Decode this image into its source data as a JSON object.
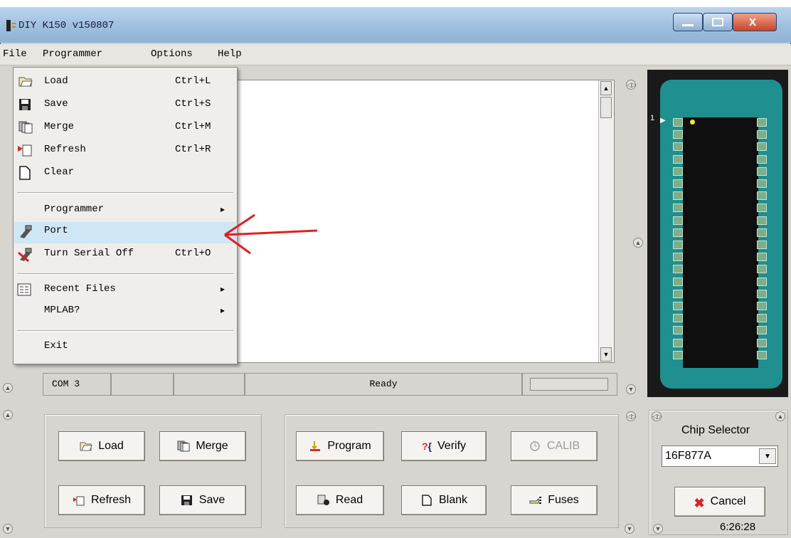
{
  "window": {
    "title": "DIY K150 v150807"
  },
  "menubar": {
    "items": [
      "File",
      "Programmer",
      "Options",
      "Help"
    ]
  },
  "file_menu": {
    "items": [
      {
        "label": "Load",
        "shortcut": "Ctrl+L",
        "icon": "folder-open-icon"
      },
      {
        "label": "Save",
        "shortcut": "Ctrl+S",
        "icon": "floppy-disk-icon"
      },
      {
        "label": "Merge",
        "shortcut": "Ctrl+M",
        "icon": "merge-pages-icon"
      },
      {
        "label": "Refresh",
        "shortcut": "Ctrl+R",
        "icon": "refresh-doc-icon"
      },
      {
        "label": "Clear",
        "shortcut": "",
        "icon": "blank-page-icon"
      },
      {
        "label": "Programmer",
        "shortcut": "",
        "submenu": "▸"
      },
      {
        "label": "Port",
        "shortcut": "",
        "icon": "port-icon",
        "highlighted": true
      },
      {
        "label": "Turn Serial Off",
        "shortcut": "Ctrl+O",
        "icon": "serial-off-icon"
      },
      {
        "label": "Recent Files",
        "shortcut": "",
        "icon": "recent-files-icon",
        "submenu": "▸"
      },
      {
        "label": "MPLAB?",
        "shortcut": "",
        "submenu": "▸"
      },
      {
        "label": "Exit",
        "shortcut": ""
      }
    ]
  },
  "status": {
    "port": "COM 3",
    "message": "Ready"
  },
  "chip_preview": {
    "pin1_label": "1"
  },
  "buttons": {
    "load": "Load",
    "merge": "Merge",
    "refresh": "Refresh",
    "save": "Save",
    "program": "Program",
    "verify": "Verify",
    "calib": "CALIB",
    "read": "Read",
    "blank": "Blank",
    "fuses": "Fuses",
    "cancel": "Cancel"
  },
  "chip_selector": {
    "label": "Chip Selector",
    "value": "16F877A"
  },
  "clock": "6:26:28",
  "colors": {
    "accent_arrow": "#e02020",
    "chip_board": "#1f8f8f",
    "menu_highlight": "#cfe6f5"
  }
}
